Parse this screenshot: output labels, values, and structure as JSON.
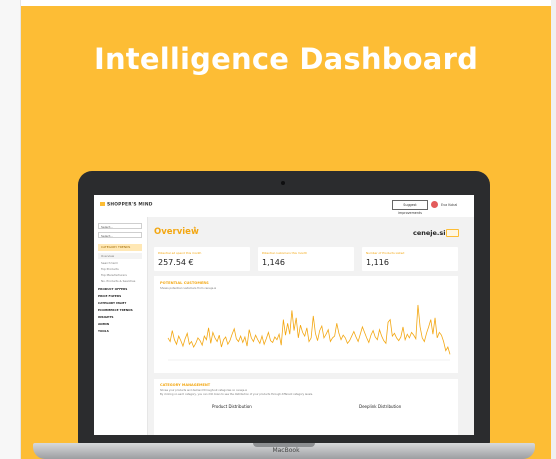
{
  "page": {
    "headline": "Intelligence Dashboard",
    "laptop_brand": "MacBook"
  },
  "app": {
    "logo_text": "SHOPPER'S MIND",
    "topbar": {
      "suggest_button": "Suggest improvements",
      "user_name": "Eva Kokal"
    },
    "sidebar": {
      "selects": [
        "Select...",
        "Select..."
      ],
      "active_section": "CATEGORY TRENDS",
      "sub_items": [
        "Overview",
        "Search term",
        "Top Products",
        "Top Manufacturers",
        "No. Products & Searches"
      ],
      "sections": [
        "PRODUCT OFFERS",
        "PRICE FILTERS",
        "CATEGORY MGMT",
        "ECOMMERCE TRENDS",
        "INSIGHTS",
        "ADMIN",
        "TOOLS"
      ]
    },
    "overview": {
      "title": "Overview",
      "shop_name": "ceneje.si"
    },
    "kpis": [
      {
        "label": "Potential ad spend this month",
        "value": "257.54 €"
      },
      {
        "label": "Potential customers this month",
        "value": "1,146"
      },
      {
        "label": "Number of Products Listed",
        "value": "1,116"
      }
    ],
    "chart": {
      "title": "POTENTIAL CUSTOMERS",
      "subtitle": "Shows potential customers from ceneje.si"
    },
    "category_section": {
      "title": "CATEGORY MANAGEMENT",
      "line1": "Shows your products and demand throughout categories on ceneje.si",
      "line2": "By clicking on each category, you can drill down to see the distribution of your products through different category levels.",
      "col1": "Product Distribution",
      "col2": "Deeplink Distribution"
    }
  },
  "chart_data": {
    "type": "line",
    "title": "POTENTIAL CUSTOMERS",
    "series": [
      {
        "values": [
          22,
          18,
          30,
          20,
          15,
          24,
          19,
          13,
          21,
          27,
          15,
          18,
          12,
          16,
          22,
          19,
          14,
          24,
          20,
          33,
          16,
          28,
          22,
          18,
          25,
          12,
          20,
          23,
          15,
          19,
          26,
          32,
          21,
          18,
          24,
          17,
          23,
          13,
          31,
          22,
          18,
          25,
          20,
          16,
          24,
          15,
          21,
          28,
          19,
          17,
          23,
          20,
          26,
          14,
          42,
          25,
          38,
          26,
          52,
          30,
          44,
          22,
          36,
          28,
          24,
          33,
          18,
          22,
          46,
          27,
          19,
          30,
          35,
          22,
          26,
          31,
          18,
          22,
          24,
          38,
          27,
          20,
          25,
          22,
          16,
          19,
          24,
          29,
          23,
          18,
          26,
          34,
          28,
          22,
          17,
          25,
          30,
          23,
          20,
          31,
          24,
          19,
          16,
          39,
          42,
          24,
          27,
          22,
          19,
          23,
          34,
          20,
          26,
          22,
          28,
          25,
          21,
          58,
          34,
          22,
          18,
          27,
          34,
          42,
          26,
          44,
          22,
          28,
          25,
          18,
          8,
          12,
          4
        ]
      }
    ],
    "ylim": [
      0,
      70
    ],
    "grid": false
  }
}
